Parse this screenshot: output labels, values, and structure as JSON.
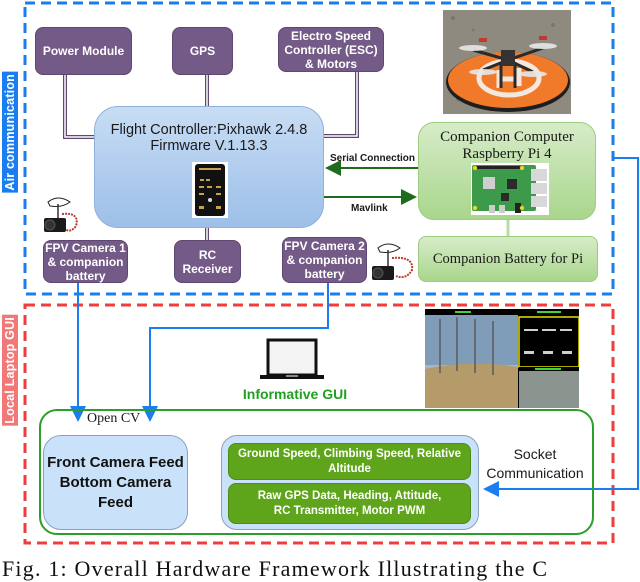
{
  "regions": {
    "air": {
      "label": "Air communication",
      "color": "#1b7ef0"
    },
    "local": {
      "label": "Local Laptop GUI",
      "color": "#f03c3c"
    }
  },
  "components": {
    "power_module": "Power Module",
    "gps": "GPS",
    "esc": [
      "Electro Speed",
      "Controller (ESC)",
      "& Motors"
    ],
    "flight_controller": [
      "Flight Controller:Pixhawk 2.4.8",
      "Firmware V.1.13.3"
    ],
    "companion_computer": [
      "Companion Computer",
      "Raspberry Pi 4"
    ],
    "companion_battery": "Companion Battery for Pi",
    "fpv_camera_1": [
      "FPV Camera 1",
      "& companion",
      "battery"
    ],
    "rc_receiver": [
      "RC",
      "Receiver"
    ],
    "fpv_camera_2": [
      "FPV Camera 2",
      "& companion",
      "battery"
    ]
  },
  "connections": {
    "serial": "Serial Connection",
    "mavlink": "Mavlink",
    "opencv": "Open CV",
    "socket": [
      "Socket",
      "Communication"
    ]
  },
  "gui": {
    "title": "Informative GUI",
    "feed_box": [
      "Front Camera Feed",
      "Bottom Camera",
      "Feed"
    ],
    "data_items": [
      [
        "Ground Speed, Climbing Speed, Relative",
        "Altitude"
      ],
      [
        "Raw GPS Data, Heading, Attitude,",
        "RC Transmitter, Motor PWM"
      ]
    ]
  },
  "images": {
    "drone_photo": "drone-on-landing-pad-photo",
    "pixhawk": "pixhawk-board-image",
    "raspberry_pi": "raspberry-pi-board-image",
    "fpv_cam": "fpv-camera-image",
    "laptop": "laptop-icon",
    "gui_screenshot": "gui-screenshot-image"
  },
  "colors": {
    "purple": "#745a87",
    "wire_purple": "#5e4770",
    "link_green": "#1e6b1e",
    "data_green": "#5ea51b",
    "gui_border": "#2aa02a",
    "socket_blue": "#1b7ef0"
  },
  "caption": "Fig. 1: Overall Hardware Framework Illustrating the C"
}
